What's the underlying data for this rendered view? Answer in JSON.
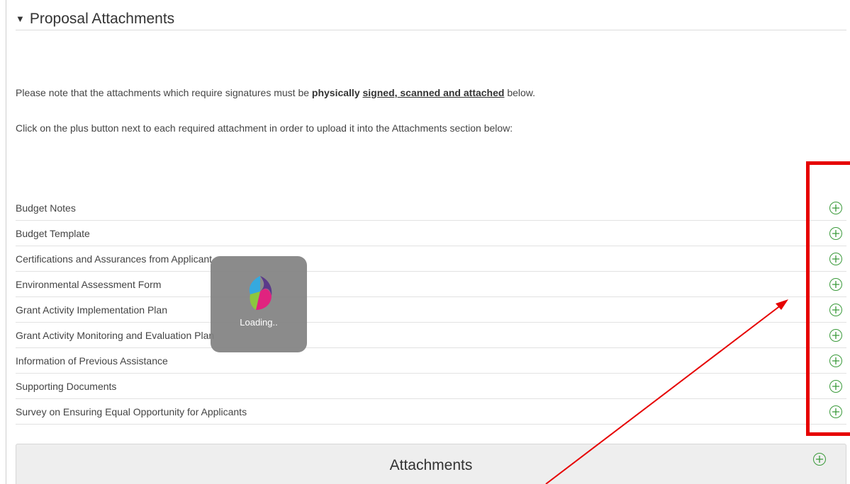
{
  "section": {
    "caret": "▼",
    "title": "Proposal Attachments"
  },
  "notes": {
    "line1_prefix": "Please note that the attachments which require signatures must be ",
    "line1_bold_1": "physically ",
    "line1_bold_underlined": "signed, scanned and attached",
    "line1_suffix": " below.",
    "line2": "Click on the plus button next to each required attachment in order to upload it into the Attachments section below:"
  },
  "required_attachments": [
    {
      "label": "Budget Notes"
    },
    {
      "label": "Budget Template"
    },
    {
      "label": "Certifications and Assurances from Applicant"
    },
    {
      "label": "Environmental Assessment Form"
    },
    {
      "label": "Grant Activity Implementation Plan"
    },
    {
      "label": "Grant Activity Monitoring and Evaluation Plan"
    },
    {
      "label": "Information of Previous Assistance"
    },
    {
      "label": "Supporting Documents"
    },
    {
      "label": "Survey on Ensuring Equal Opportunity for Applicants"
    }
  ],
  "attachments_bar": {
    "title": "Attachments"
  },
  "loading": {
    "text": "Loading.."
  },
  "icons": {
    "add": "plus-circle-icon",
    "logo": "app-logo-icon"
  },
  "colors": {
    "accent_green": "#3a9a3a",
    "annotation_red": "#e60000"
  }
}
